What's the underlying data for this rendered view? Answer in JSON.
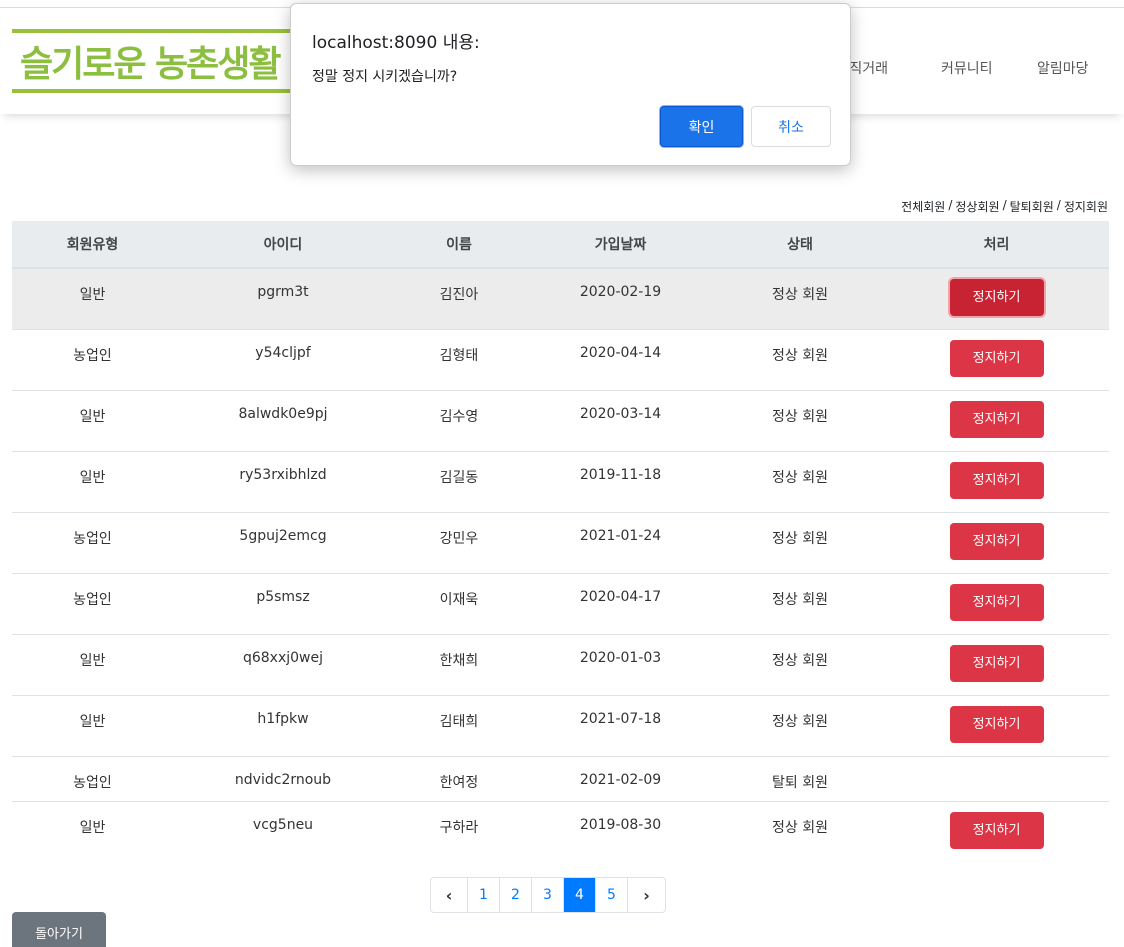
{
  "header": {
    "logo_text": "슬기로운 농촌생활",
    "nav": [
      "물 직거래",
      "커뮤니티",
      "알림마당"
    ]
  },
  "filters": [
    "전체회원",
    "정상회원",
    "탈퇴회원",
    "정지회원"
  ],
  "table": {
    "headers": [
      "회원유형",
      "아이디",
      "이름",
      "가입날짜",
      "상태",
      "처리"
    ],
    "rows": [
      {
        "type": "일반",
        "id": "pgrm3t",
        "name": "김진아",
        "date": "2020-02-19",
        "status": "정상 회원",
        "action": "정지하기"
      },
      {
        "type": "농업인",
        "id": "y54cljpf",
        "name": "김형태",
        "date": "2020-04-14",
        "status": "정상 회원",
        "action": "정지하기"
      },
      {
        "type": "일반",
        "id": "8alwdk0e9pj",
        "name": "김수영",
        "date": "2020-03-14",
        "status": "정상 회원",
        "action": "정지하기"
      },
      {
        "type": "일반",
        "id": "ry53rxibhlzd",
        "name": "김길동",
        "date": "2019-11-18",
        "status": "정상 회원",
        "action": "정지하기"
      },
      {
        "type": "농업인",
        "id": "5gpuj2emcg",
        "name": "강민우",
        "date": "2021-01-24",
        "status": "정상 회원",
        "action": "정지하기"
      },
      {
        "type": "농업인",
        "id": "p5smsz",
        "name": "이재욱",
        "date": "2020-04-17",
        "status": "정상 회원",
        "action": "정지하기"
      },
      {
        "type": "일반",
        "id": "q68xxj0wej",
        "name": "한채희",
        "date": "2020-01-03",
        "status": "정상 회원",
        "action": "정지하기"
      },
      {
        "type": "일반",
        "id": "h1fpkw",
        "name": "김태희",
        "date": "2021-07-18",
        "status": "정상 회원",
        "action": "정지하기"
      },
      {
        "type": "농업인",
        "id": "ndvidc2rnoub",
        "name": "한여정",
        "date": "2021-02-09",
        "status": "탈퇴 회원",
        "action": ""
      },
      {
        "type": "일반",
        "id": "vcg5neu",
        "name": "구하라",
        "date": "2019-08-30",
        "status": "정상 회원",
        "action": "정지하기"
      }
    ]
  },
  "pagination": {
    "prev": "‹",
    "pages": [
      "1",
      "2",
      "3",
      "4",
      "5"
    ],
    "current": "4",
    "next": "›"
  },
  "back_button": "돌아가기",
  "dialog": {
    "title": "localhost:8090 내용:",
    "message": "정말 정지 시키겠습니까?",
    "ok": "확인",
    "cancel": "취소"
  },
  "colors": {
    "accent": "#007bff",
    "danger": "#dc3545",
    "logo": "#8cbf3f",
    "dialog_ok": "#1a73e8"
  }
}
